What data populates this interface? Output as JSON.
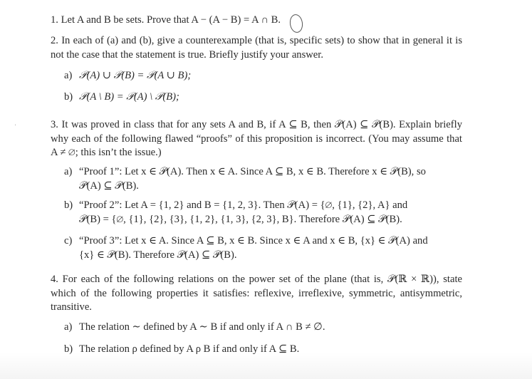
{
  "document": {
    "q1": {
      "text": "1. Let A and B be sets. Prove that A − (A − B) = A ∩ B."
    },
    "q2": {
      "intro": "2. In each of (a) and (b), give a counterexample (that is, specific sets) to show that in general it is not the case that the statement is true. Briefly justify your answer.",
      "parts": [
        {
          "label": "a)",
          "text": "𝒫(A) ∪ 𝒫(B) = 𝒫(A ∪ B);"
        },
        {
          "label": "b)",
          "text": "𝒫(A \\ B) = 𝒫(A) \\ 𝒫(B);"
        }
      ]
    },
    "q3": {
      "intro": "3. It was proved in class that for any sets A and B, if A ⊆ B, then 𝒫(A) ⊆ 𝒫(B). Explain briefly why each of the following flawed “proofs” of this proposition is incorrect. (You may assume that A ≠ ∅; this isn’t the issue.)",
      "parts": [
        {
          "label": "a)",
          "line1": "“Proof 1”: Let x ∈ 𝒫(A). Then x ∈ A. Since A ⊆ B, x ∈ B. Therefore x ∈ 𝒫(B), so",
          "line2": "𝒫(A) ⊆ 𝒫(B)."
        },
        {
          "label": "b)",
          "line1": "“Proof 2”: Let A = {1, 2} and B = {1, 2, 3}. Then 𝒫(A) = {∅, {1}, {2}, A} and",
          "line2": "𝒫(B) = {∅, {1}, {2}, {3}, {1, 2}, {1, 3}, {2, 3}, B}. Therefore 𝒫(A) ⊆ 𝒫(B)."
        },
        {
          "label": "c)",
          "line1": "“Proof 3”: Let x ∈ A. Since A ⊆ B, x ∈ B. Since x ∈ A and x ∈ B, {x} ∈ 𝒫(A) and",
          "line2": "{x} ∈ 𝒫(B). Therefore 𝒫(A) ⊆ 𝒫(B)."
        }
      ]
    },
    "q4": {
      "intro": "4. For each of the following relations on the power set of the plane (that is, 𝒫(ℝ × ℝ)), state which of the following properties it satisfies: reflexive, irreflexive, symmetric, antisymmetric, transitive.",
      "parts": [
        {
          "label": "a)",
          "text": "The relation ∼ defined by A ∼ B if and only if A ∩ B ≠ ∅."
        },
        {
          "label": "b)",
          "text": "The relation ρ defined by A ρ B if and only if A ⊆ B."
        }
      ]
    }
  }
}
